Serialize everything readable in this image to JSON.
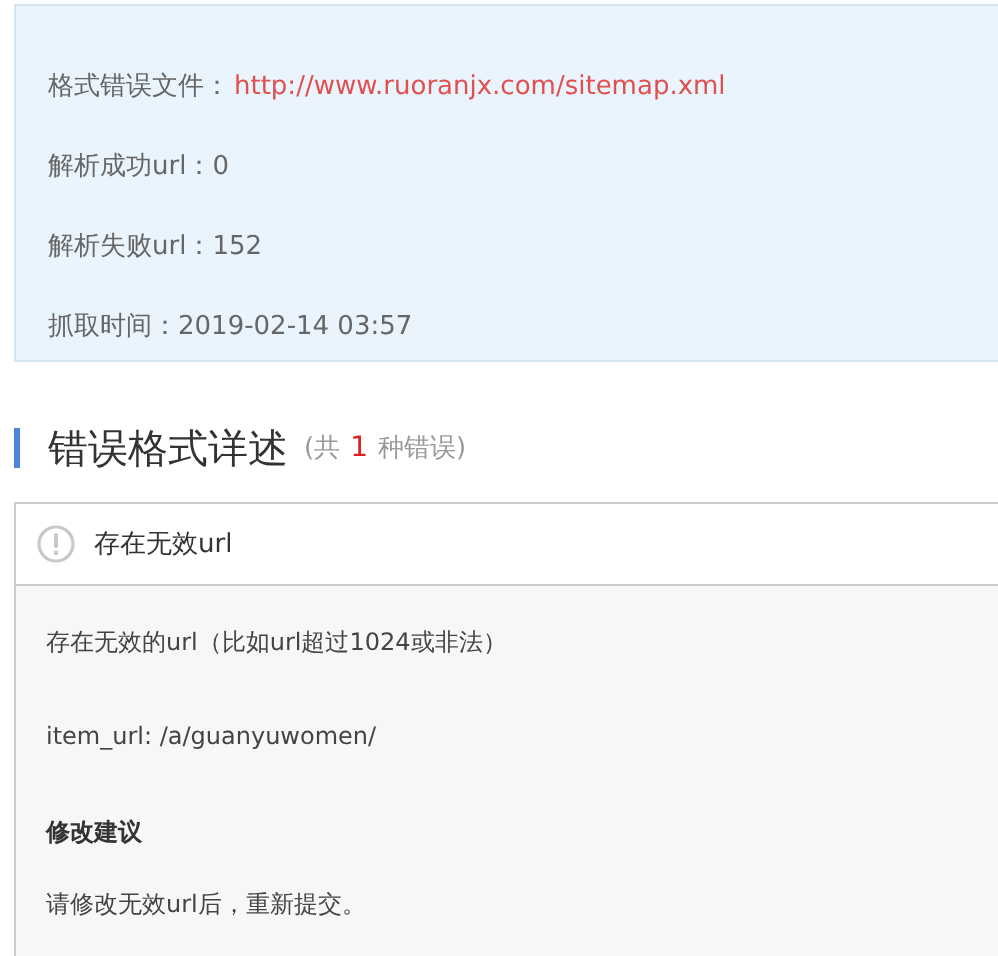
{
  "summary": [
    {
      "label": "格式错误文件：",
      "value": "http://www.ruoranjx.com/sitemap.xml",
      "kind": "link"
    },
    {
      "label": "解析成功url：",
      "value": "0",
      "kind": "text"
    },
    {
      "label": "解析失败url：",
      "value": "152",
      "kind": "text"
    },
    {
      "label": "抓取时间：",
      "value": "2019-02-14 03:57",
      "kind": "text"
    }
  ],
  "section": {
    "title": "错误格式详述",
    "count_prefix": "(共",
    "count": "1",
    "count_suffix": "种错误)"
  },
  "error_card": {
    "title": "存在无效url",
    "body": [
      {
        "kind": "text",
        "text": "存在无效的url（比如url超过1024或非法）"
      },
      {
        "kind": "text",
        "text": "item_url: /a/guanyuwomen/"
      },
      {
        "kind": "heading",
        "text": "修改建议"
      },
      {
        "kind": "text",
        "text": "请修改无效url后，重新提交。"
      }
    ]
  }
}
